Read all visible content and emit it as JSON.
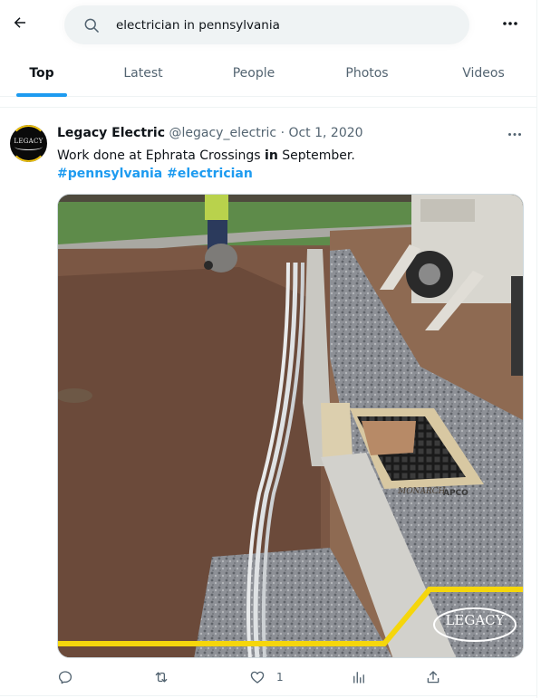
{
  "header": {
    "back_icon": "arrow-left-icon",
    "search": {
      "icon": "search-icon",
      "value": "electrician in pennsylvania",
      "placeholder": "Search"
    },
    "more_icon": "more-horizontal-icon"
  },
  "tabs": [
    {
      "label": "Top",
      "active": true
    },
    {
      "label": "Latest",
      "active": false
    },
    {
      "label": "People",
      "active": false
    },
    {
      "label": "Photos",
      "active": false
    },
    {
      "label": "Videos",
      "active": false
    }
  ],
  "colors": {
    "accent": "#1d9bf0",
    "text_primary": "#0f1419",
    "text_secondary": "#536471",
    "border": "#eff3f4"
  },
  "tweet": {
    "author": {
      "name": "Legacy Electric",
      "handle": "@legacy_electric",
      "avatar_text": "LEGACY"
    },
    "separator": "·",
    "timestamp": "Oct 1, 2020",
    "text": {
      "before": "Work done at Ephrata Crossings ",
      "bold": "in",
      "after": " September."
    },
    "hashtags": [
      "#pennsylvania",
      "#electrician"
    ],
    "media": {
      "description": "Construction site with electrical conduit laid along a concrete curb and a storm drain grate",
      "watermark": "LEGACY",
      "grate_labels": [
        "MONARCH",
        "APCO"
      ]
    },
    "actions": {
      "reply": {
        "icon": "reply-icon",
        "count": ""
      },
      "retweet": {
        "icon": "retweet-icon",
        "count": ""
      },
      "like": {
        "icon": "heart-icon",
        "count": "1"
      },
      "views": {
        "icon": "views-icon",
        "count": ""
      },
      "share": {
        "icon": "share-icon",
        "count": ""
      }
    }
  }
}
